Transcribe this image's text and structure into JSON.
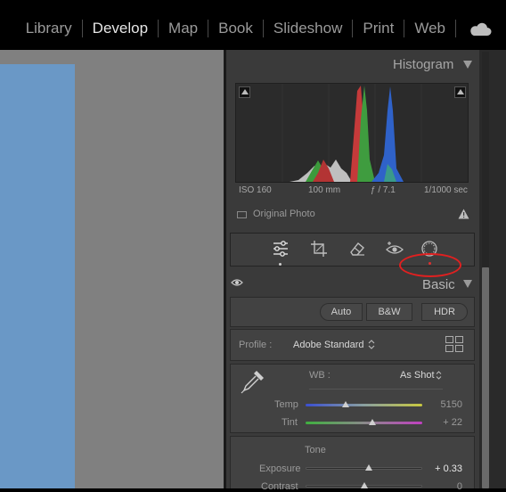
{
  "modules": [
    {
      "label": "Library",
      "active": false
    },
    {
      "label": "Develop",
      "active": true
    },
    {
      "label": "Map",
      "active": false
    },
    {
      "label": "Book",
      "active": false
    },
    {
      "label": "Slideshow",
      "active": false
    },
    {
      "label": "Print",
      "active": false
    },
    {
      "label": "Web",
      "active": false
    }
  ],
  "histogram": {
    "title": "Histogram",
    "iso": "ISO 160",
    "focal_length": "100 mm",
    "aperture": "ƒ / 7.1",
    "shutter": "1/1000 sec",
    "original_photo_label": "Original Photo"
  },
  "tools": [
    "sliders-icon",
    "crop-icon",
    "eraser-icon",
    "redeye-icon",
    "masking-icon"
  ],
  "basic": {
    "title": "Basic",
    "auto_label": "Auto",
    "bw_label": "B&W",
    "hdr_label": "HDR",
    "profile_label": "Profile :",
    "profile_value": "Adobe Standard",
    "wb_label": "WB :",
    "wb_value": "As Shot",
    "temp_label": "Temp",
    "temp_value": "5150",
    "temp_position": 0.34,
    "tint_label": "Tint",
    "tint_value": "+ 22",
    "tint_position": 0.57,
    "tone_label": "Tone",
    "exposure_label": "Exposure",
    "exposure_value": "+ 0.33",
    "exposure_position": 0.54,
    "contrast_label": "Contrast",
    "contrast_value": "0",
    "contrast_position": 0.5
  },
  "colors": {
    "accent_red": "#e02020",
    "panel_bg": "#3a3a3a",
    "photo_blue": "#6a98c6"
  }
}
